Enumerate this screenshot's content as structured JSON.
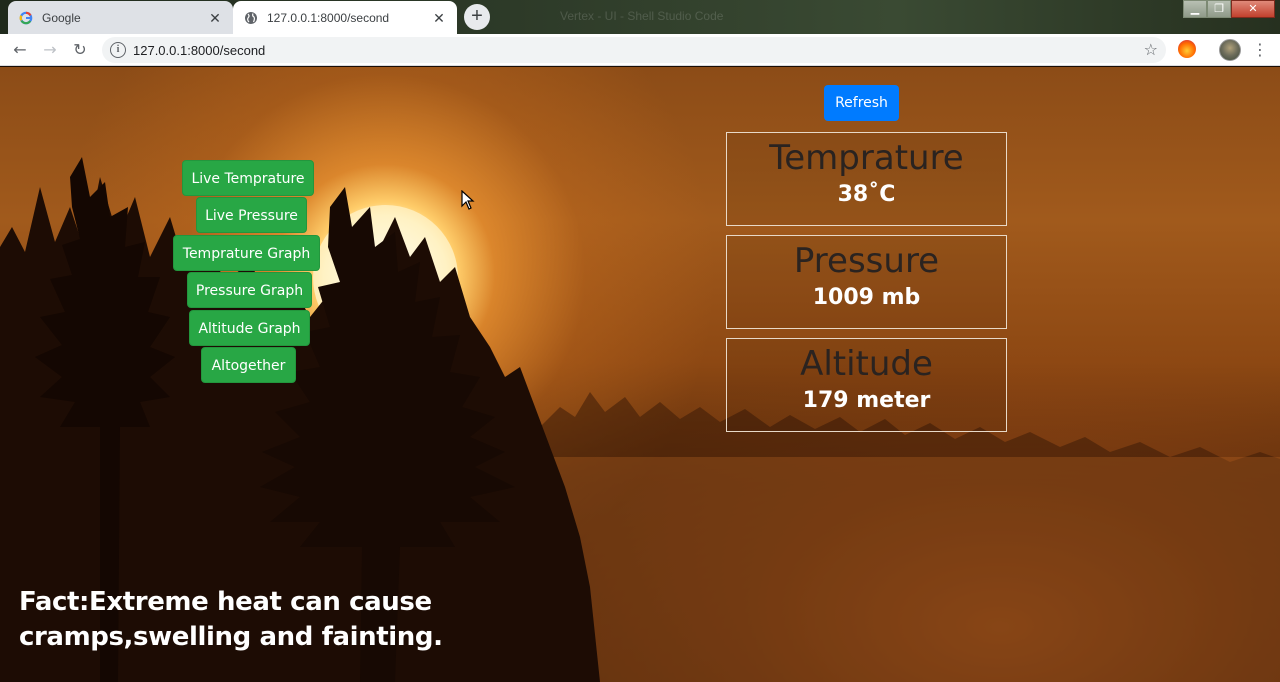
{
  "browser": {
    "tabs": [
      {
        "title": "Google",
        "favicon": "google-g-icon",
        "active": false
      },
      {
        "title": "127.0.0.1:8000/second",
        "favicon": "globe-icon",
        "active": true
      }
    ],
    "window_title_faint": "Vertex - UI - Shell Studio Code",
    "url": "127.0.0.1:8000/second",
    "close_glyph": "✕",
    "new_tab_glyph": "+"
  },
  "page": {
    "refresh_label": "Refresh",
    "nav_buttons": [
      {
        "label": "Live Temprature"
      },
      {
        "label": "Live Pressure"
      },
      {
        "label": "Temprature Graph"
      },
      {
        "label": "Pressure Graph"
      },
      {
        "label": "Altitude Graph"
      },
      {
        "label": "Altogether"
      }
    ],
    "cards": [
      {
        "title": "Temprature",
        "value": "38˚C"
      },
      {
        "title": "Pressure",
        "value": "1009 mb"
      },
      {
        "title": "Altitude",
        "value": "179 meter"
      }
    ],
    "fact": "Fact:Extreme heat can cause cramps,swelling and fainting."
  },
  "colors": {
    "success_green": "#28a745",
    "primary_blue": "#007bff",
    "card_title": "#2a2320"
  }
}
